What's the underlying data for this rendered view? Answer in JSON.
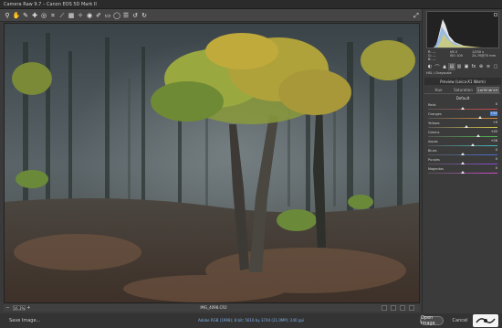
{
  "window": {
    "title": "Camera Raw 9.7  –  Canon EOS 5D Mark II"
  },
  "toolbar": {
    "tools": [
      "zoom-icon",
      "hand-icon",
      "white-balance-icon",
      "color-sampler-icon",
      "target-adjust-icon",
      "crop-icon",
      "straighten-icon",
      "transform-icon",
      "spot-removal-icon",
      "red-eye-icon",
      "adjustment-brush-icon",
      "graduated-filter-icon",
      "radial-filter-icon",
      "preferences-icon",
      "rotate-left-icon",
      "rotate-right-icon"
    ],
    "fullscreen_icon": "fullscreen-icon"
  },
  "histogram": {
    "corner_icon": "clipping-warning-icon"
  },
  "readout": {
    "r": "R: ---",
    "g": "G: ---",
    "b": "B: ---",
    "aperture": "f/6.3",
    "shutter": "1/250 s",
    "iso": "ISO 100",
    "lens": "24-70@70 mm"
  },
  "panel_tabs": [
    "basic-panel-icon",
    "tone-curve-icon",
    "detail-icon",
    "hsl-icon",
    "split-toning-icon",
    "lens-corrections-icon",
    "effects-icon",
    "camera-calibration-icon",
    "presets-icon",
    "snapshots-icon"
  ],
  "profile_row": "HSL / Grayscale",
  "section_header": "Preview (Leica-X1 Warm)",
  "subtabs": [
    "Hue",
    "Saturation",
    "Luminance"
  ],
  "active_subtab": 2,
  "subpanel_title": "Default",
  "sliders": [
    {
      "label": "Reds",
      "value": "0",
      "pos": 0.5
    },
    {
      "label": "Oranges",
      "value": "+50",
      "pos": 0.75,
      "highlight": true
    },
    {
      "label": "Yellows",
      "value": "+9",
      "pos": 0.55
    },
    {
      "label": "Greens",
      "value": "+45",
      "pos": 0.73
    },
    {
      "label": "Aquas",
      "value": "+28",
      "pos": 0.64
    },
    {
      "label": "Blues",
      "value": "0",
      "pos": 0.5
    },
    {
      "label": "Purples",
      "value": "0",
      "pos": 0.5
    },
    {
      "label": "Magentas",
      "value": "0",
      "pos": 0.5
    }
  ],
  "slider_colors": [
    [
      "#d24a4a",
      "#d24a4a"
    ],
    [
      "#d88a36",
      "#d88a36"
    ],
    [
      "#d6c64a",
      "#d6c64a"
    ],
    [
      "#4fbe4f",
      "#4fbe4f"
    ],
    [
      "#45bcbc",
      "#45bcbc"
    ],
    [
      "#4a6fd6",
      "#4a6fd6"
    ],
    [
      "#8a4ad6",
      "#8a4ad6"
    ],
    [
      "#d24ad2",
      "#d24ad2"
    ]
  ],
  "statusbar": {
    "zoom": "16.3%",
    "filename": "IMG_4098.CR2"
  },
  "bottom": {
    "save_label": "Save Image...",
    "workflow_link": "Adobe RGB (1998); 8 bit; 5616 by 3744 (21.0MP); 240 ppi",
    "open_label": "Open Image",
    "cancel_label": "Cancel"
  }
}
